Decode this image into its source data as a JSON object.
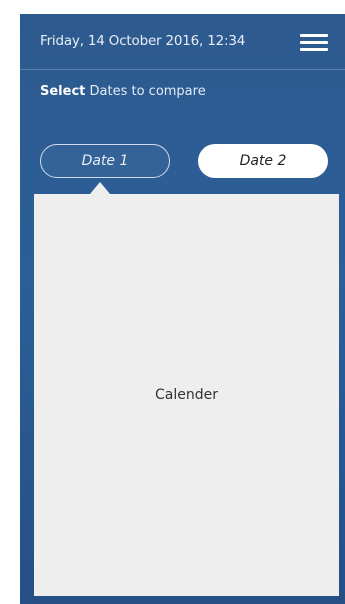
{
  "header": {
    "datetime": "Friday, 14 October 2016, 12:34",
    "menu_icon": "hamburger-menu-icon"
  },
  "instruction": {
    "bold": "Select",
    "rest": " Dates to compare"
  },
  "tabs": [
    {
      "label": "Date 1",
      "selected": true
    },
    {
      "label": "Date 2",
      "selected": false
    }
  ],
  "calendar": {
    "label": "Calender"
  },
  "colors": {
    "background": "#2b5f98",
    "calendar_panel": "#eeeeee",
    "tab_active_fill": "#ffffff"
  }
}
